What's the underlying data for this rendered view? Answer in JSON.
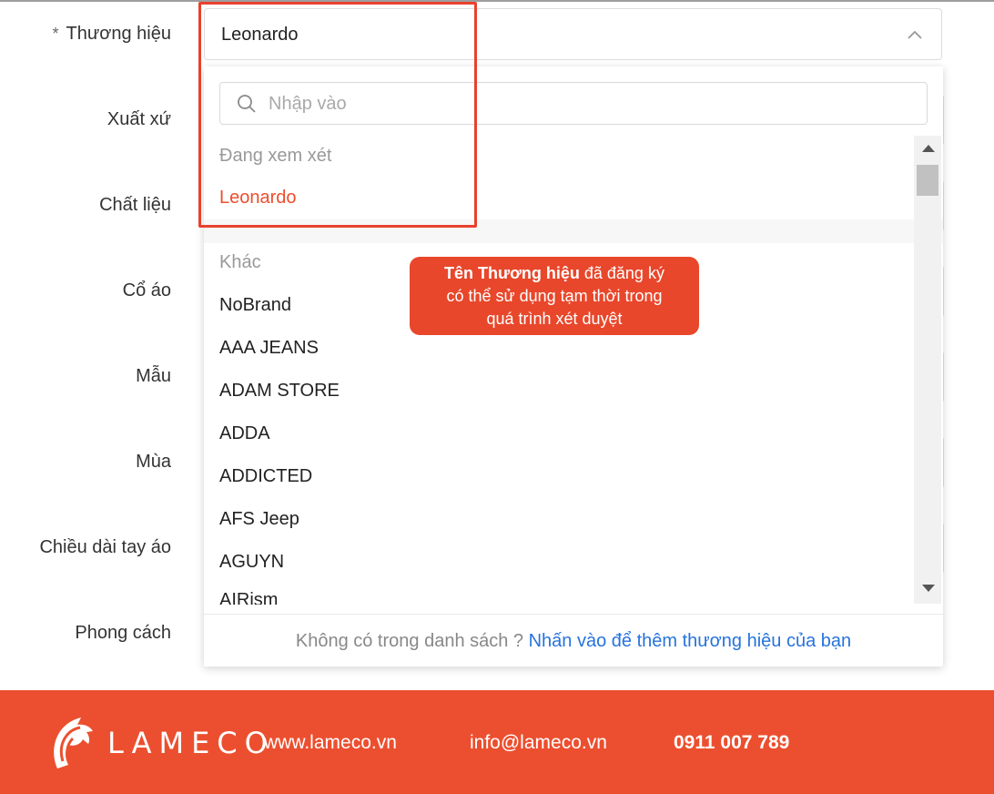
{
  "form": {
    "labels": {
      "required_mark": "*",
      "brand": "Thương hiệu",
      "origin": "Xuất xứ",
      "material": "Chất liệu",
      "collar": "Cổ áo",
      "pattern": "Mẫu",
      "season": "Mùa",
      "sleeve_length": "Chiều dài tay áo",
      "style": "Phong cách"
    },
    "brand_select": {
      "value": "Leonardo",
      "icon": "chevron-up-icon"
    }
  },
  "dropdown": {
    "search_placeholder": "Nhập vào",
    "search_icon": "search-icon",
    "pending_group_title": "Đang xem xét",
    "pending_items": [
      "Leonardo"
    ],
    "other_group_title": "Khác",
    "items": [
      "NoBrand",
      "AAA JEANS",
      "ADAM STORE",
      "ADDA",
      "ADDICTED",
      "AFS Jeep",
      "AGUYN",
      "AIRism"
    ],
    "footer_text": "Không có trong danh sách ?",
    "footer_link": "Nhấn vào để thêm thương hiệu của bạn"
  },
  "callout": {
    "bold": "Tên Thương hiệu",
    "line1_rest": " đã đăng ký",
    "line2": "có thể sử dụng tạm thời trong",
    "line3": "quá trình xét duyệt"
  },
  "footer": {
    "logo_text": "LAMECO",
    "website": "www.lameco.vn",
    "email": "info@lameco.vn",
    "phone": "0911 007 789"
  },
  "colors": {
    "accent": "#ee4d2d",
    "footer_bg": "#ec4f2f",
    "link": "#2673dd",
    "highlight_border": "#e8412e"
  }
}
